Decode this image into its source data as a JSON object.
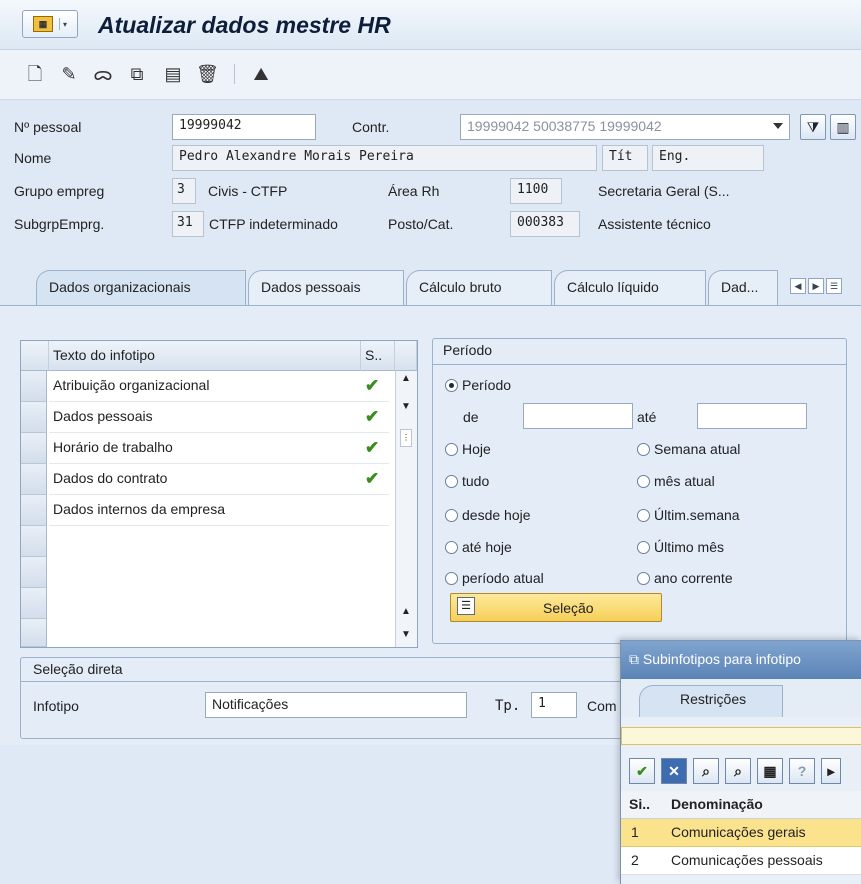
{
  "title": "Atualizar dados mestre HR",
  "header": {
    "pernr_label": "Nº pessoal",
    "pernr_value": "19999042",
    "contr_label": "Contr.",
    "contr_value": "19999042 50038775 19999042",
    "nome_label": "Nome",
    "nome_value": "Pedro Alexandre Morais Pereira",
    "tit_label": "Tít",
    "tit_value": "Eng.",
    "grupo_label": "Grupo empreg",
    "grupo_code": "3",
    "grupo_text": "Civis - CTFP",
    "area_label": "Área Rh",
    "area_code": "1100",
    "area_text": "Secretaria Geral (S...",
    "subgrp_label": "SubgrpEmprg.",
    "subgrp_code": "31",
    "subgrp_text": "CTFP indeterminado",
    "posto_label": "Posto/Cat.",
    "posto_code": "000383",
    "posto_text": "Assistente técnico"
  },
  "tabs": [
    {
      "label": "Dados organizacionais"
    },
    {
      "label": "Dados pessoais"
    },
    {
      "label": "Cálculo bruto"
    },
    {
      "label": "Cálculo líquido"
    },
    {
      "label": "Dad..."
    }
  ],
  "infotipo_table": {
    "col_text": "Texto do infotipo",
    "col_s": "S..",
    "rows": [
      {
        "text": "Atribuição organizacional",
        "checked": true
      },
      {
        "text": "Dados pessoais",
        "checked": true
      },
      {
        "text": "Horário de trabalho",
        "checked": true
      },
      {
        "text": "Dados do contrato",
        "checked": true
      },
      {
        "text": "Dados internos da empresa",
        "checked": false
      }
    ]
  },
  "periodo": {
    "title": "Período",
    "periodo_radio": "Período",
    "de_label": "de",
    "ate_label": "até",
    "options_left": [
      "Hoje",
      "tudo",
      "desde hoje",
      "até hoje",
      "período atual"
    ],
    "options_right": [
      "Semana atual",
      "mês atual",
      "Últim.semana",
      "Último mês",
      "ano corrente"
    ],
    "selecao_button": "Seleção"
  },
  "selecao_direta": {
    "title": "Seleção direta",
    "infotipo_label": "Infotipo",
    "infotipo_value": "Notificações",
    "tp_label": "Tp.",
    "tp_value": "1",
    "com_label": "Com"
  },
  "popup": {
    "title": "Subinfotipos para infotipo",
    "tab": "Restrições",
    "col_si": "Si..",
    "col_denominacao": "Denominação",
    "rows": [
      {
        "code": "1",
        "text": "Comunicações gerais"
      },
      {
        "code": "2",
        "text": "Comunicações pessoais"
      }
    ]
  },
  "icons": {
    "check_color": "#3a8d1c",
    "highlight_row_color": "#fbe38e",
    "button_yellow": "#f6cf58"
  }
}
